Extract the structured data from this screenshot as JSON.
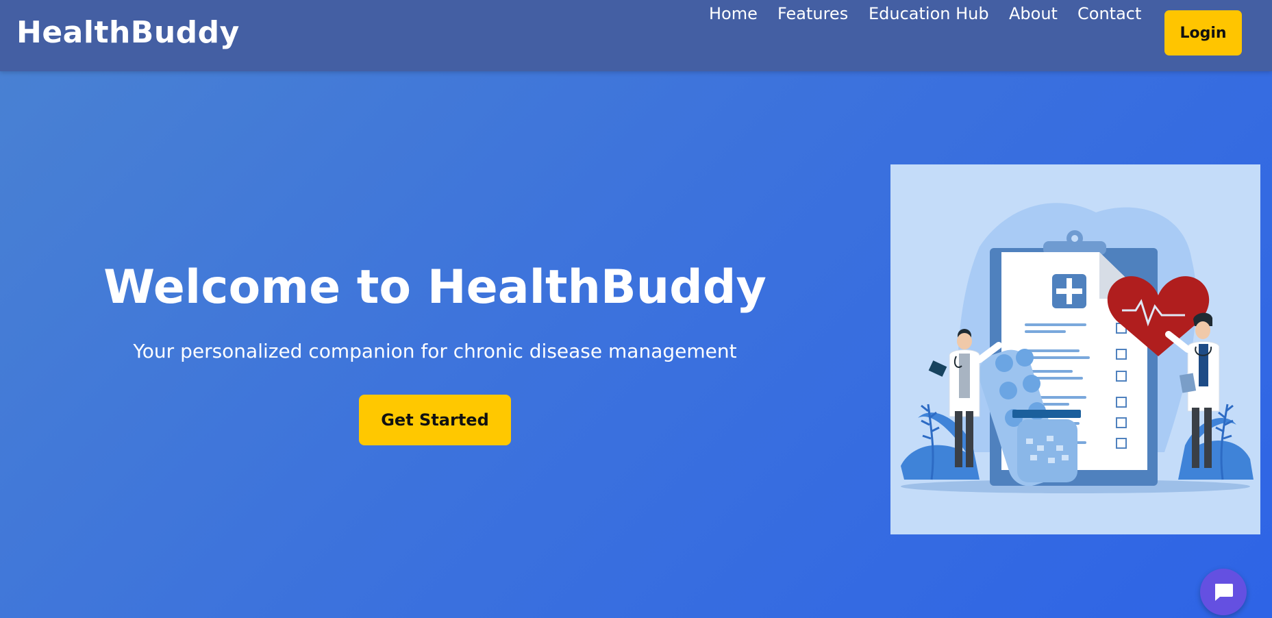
{
  "brand": {
    "name": "HealthBuddy"
  },
  "nav": {
    "links": [
      "Home",
      "Features",
      "Education Hub",
      "About",
      "Contact"
    ],
    "login_label": "Login"
  },
  "hero": {
    "title": "Welcome to HealthBuddy",
    "subtitle": "Your personalized companion for chronic disease management",
    "cta_label": "Get Started"
  },
  "icons": {
    "chat": "chat-bubble-icon"
  },
  "colors": {
    "navbar": "#445fa3",
    "accent": "#ffc500",
    "chat_button": "#6450e1",
    "hero_gradient_start": "#4a82d2",
    "hero_gradient_end": "#2e64e6"
  }
}
